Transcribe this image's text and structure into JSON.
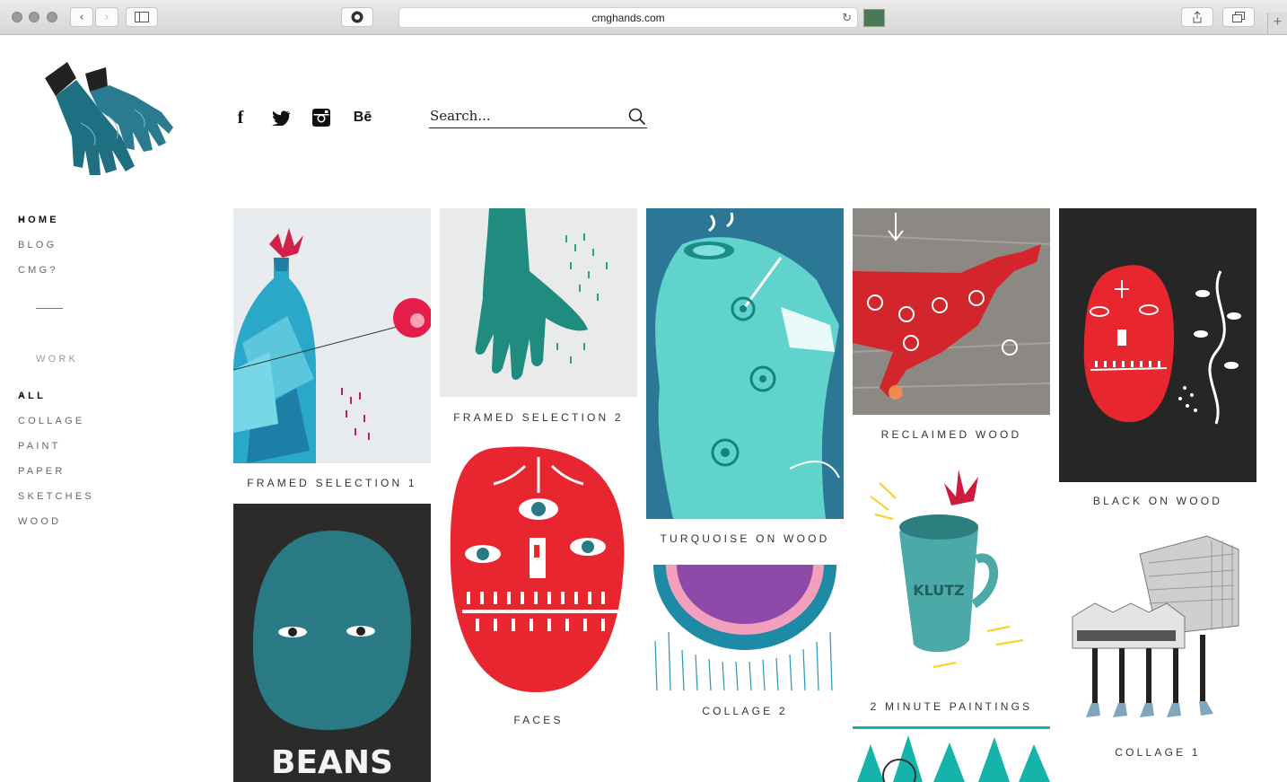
{
  "browser": {
    "url": "cmghands.com"
  },
  "header": {
    "social_links": [
      {
        "icon": "facebook-icon",
        "glyph": "f"
      },
      {
        "icon": "twitter-icon",
        "glyph": ""
      },
      {
        "icon": "instagram-icon",
        "glyph": ""
      },
      {
        "icon": "behance-icon",
        "glyph": "Bē"
      }
    ],
    "search": {
      "placeholder": "Search..."
    }
  },
  "nav": {
    "items": [
      {
        "label": "HOME",
        "active": true
      },
      {
        "label": "BLOG",
        "active": false
      },
      {
        "label": "CMG?",
        "active": false
      }
    ],
    "work_heading": "WORK",
    "work_items": [
      {
        "label": "ALL",
        "active": true
      },
      {
        "label": "COLLAGE",
        "active": false
      },
      {
        "label": "PAINT",
        "active": false
      },
      {
        "label": "PAPER",
        "active": false
      },
      {
        "label": "SKETCHES",
        "active": false
      },
      {
        "label": "WOOD",
        "active": false
      }
    ],
    "active_marker": "×"
  },
  "gallery": {
    "tiles": [
      {
        "caption": "FRAMED SELECTION 1"
      },
      {
        "caption": "FRAMED SELECTION 2"
      },
      {
        "caption": "TURQUOISE ON WOOD"
      },
      {
        "caption": "RECLAIMED WOOD"
      },
      {
        "caption": "BLACK ON WOOD"
      },
      {
        "caption": "",
        "art_text": "BEANS"
      },
      {
        "caption": "FACES"
      },
      {
        "caption": "COLLAGE 2"
      },
      {
        "caption": "2 MINUTE PAINTINGS",
        "art_text": "KLUTZ"
      },
      {
        "caption": "COLLAGE 1"
      },
      {
        "caption": ""
      }
    ]
  },
  "colors": {
    "teal": "#1e6f82",
    "red": "#e8262f",
    "turquoise": "#5fd3cc",
    "dark": "#262626"
  }
}
